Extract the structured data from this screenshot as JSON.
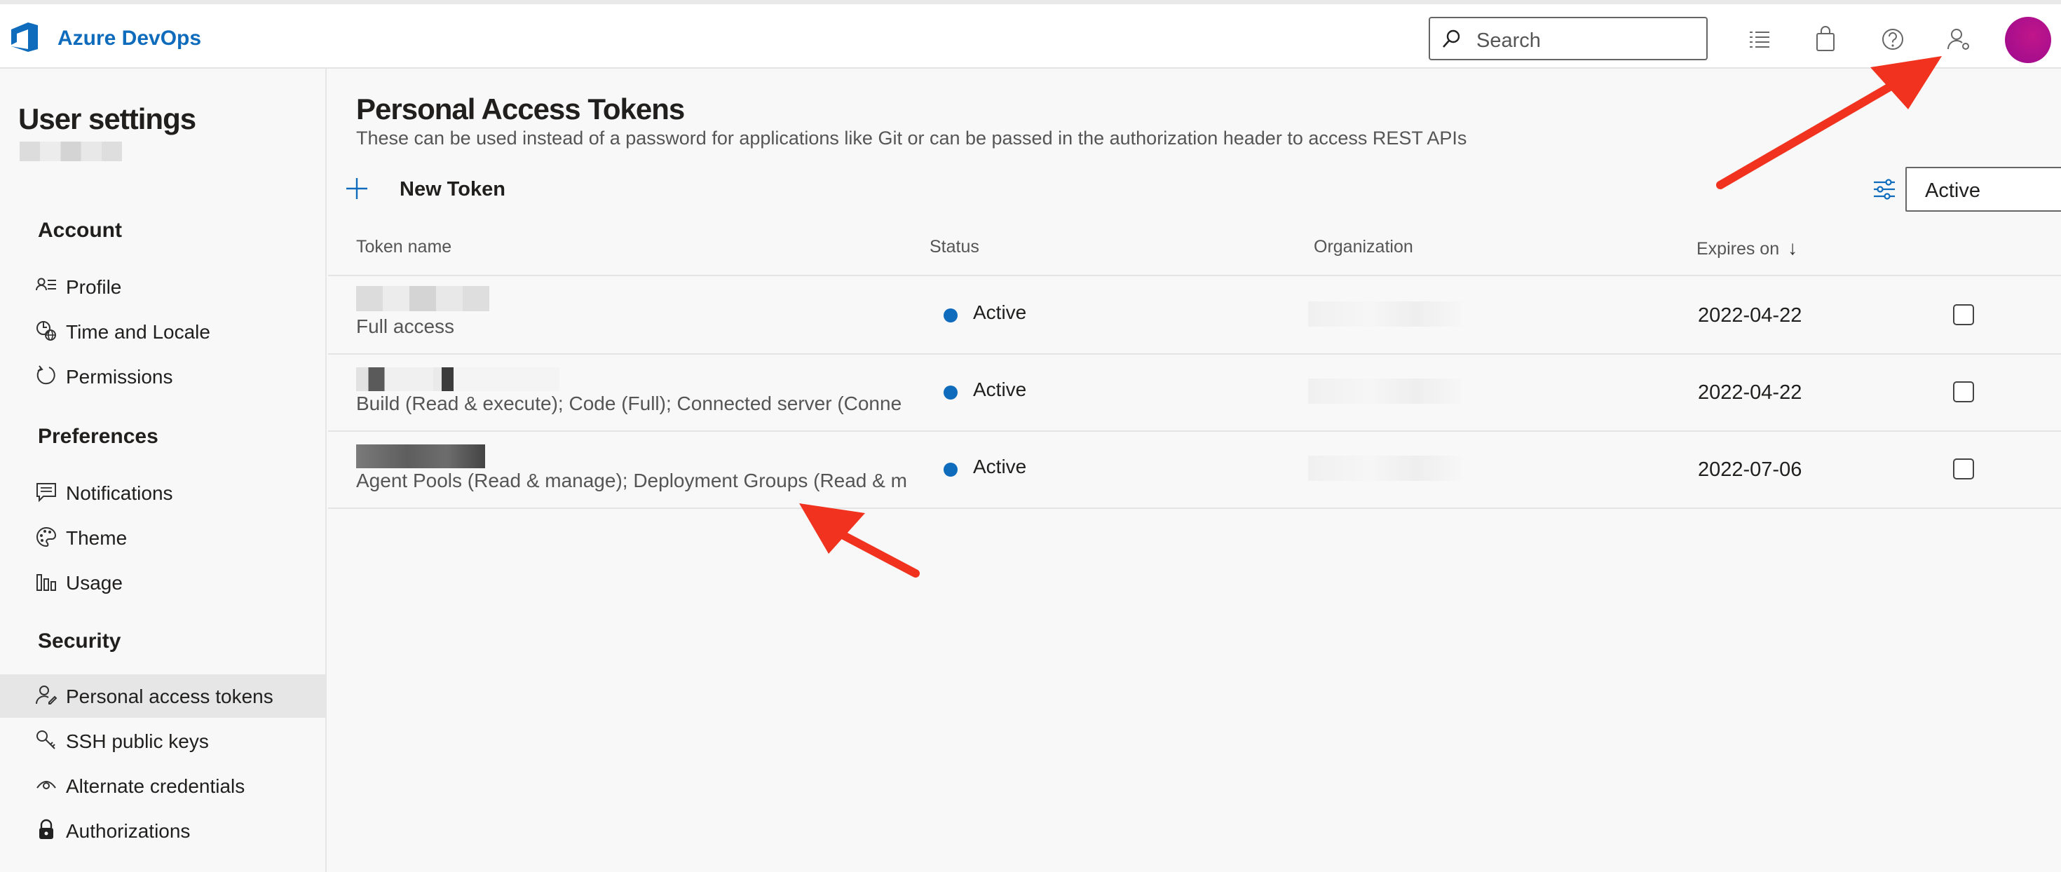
{
  "header": {
    "brand": "Azure DevOps",
    "search_placeholder": "Search",
    "icons": [
      "logo-icon",
      "search-icon",
      "work-items-icon",
      "marketplace-icon",
      "help-icon",
      "user-settings-icon"
    ],
    "accent_color": "#0f6cbd",
    "avatar_color": "#b5118c"
  },
  "sidebar": {
    "title": "User settings",
    "sections": [
      {
        "heading": "Account",
        "items": [
          {
            "label": "Profile",
            "icon": "profile-icon"
          },
          {
            "label": "Time and Locale",
            "icon": "globe-clock-icon"
          },
          {
            "label": "Permissions",
            "icon": "permissions-icon"
          }
        ]
      },
      {
        "heading": "Preferences",
        "items": [
          {
            "label": "Notifications",
            "icon": "notifications-icon"
          },
          {
            "label": "Theme",
            "icon": "palette-icon"
          },
          {
            "label": "Usage",
            "icon": "usage-icon"
          }
        ]
      },
      {
        "heading": "Security",
        "items": [
          {
            "label": "Personal access tokens",
            "icon": "token-user-icon",
            "selected": true
          },
          {
            "label": "SSH public keys",
            "icon": "key-icon"
          },
          {
            "label": "Alternate credentials",
            "icon": "eye-icon"
          },
          {
            "label": "Authorizations",
            "icon": "lock-icon"
          }
        ]
      }
    ]
  },
  "main": {
    "title": "Personal Access Tokens",
    "subtitle": "These can be used instead of a password for applications like Git or can be passed in the authorization header to access REST APIs",
    "new_token_label": "New Token",
    "filter_value": "Active",
    "columns": [
      "Token name",
      "Status",
      "Organization",
      "Expires on"
    ],
    "sort_indicator": "↓",
    "rows": [
      {
        "scope": "Full access",
        "status": "Active",
        "expires": "2022-04-22"
      },
      {
        "scope": "Build (Read & execute); Code (Full); Connected server (Conne",
        "status": "Active",
        "expires": "2022-04-22"
      },
      {
        "scope": "Agent Pools (Read & manage); Deployment Groups (Read & m",
        "status": "Active",
        "expires": "2022-07-06"
      }
    ],
    "status_color": "#0f6cbd"
  },
  "annotations": {
    "arrow_color": "#f0321e"
  }
}
